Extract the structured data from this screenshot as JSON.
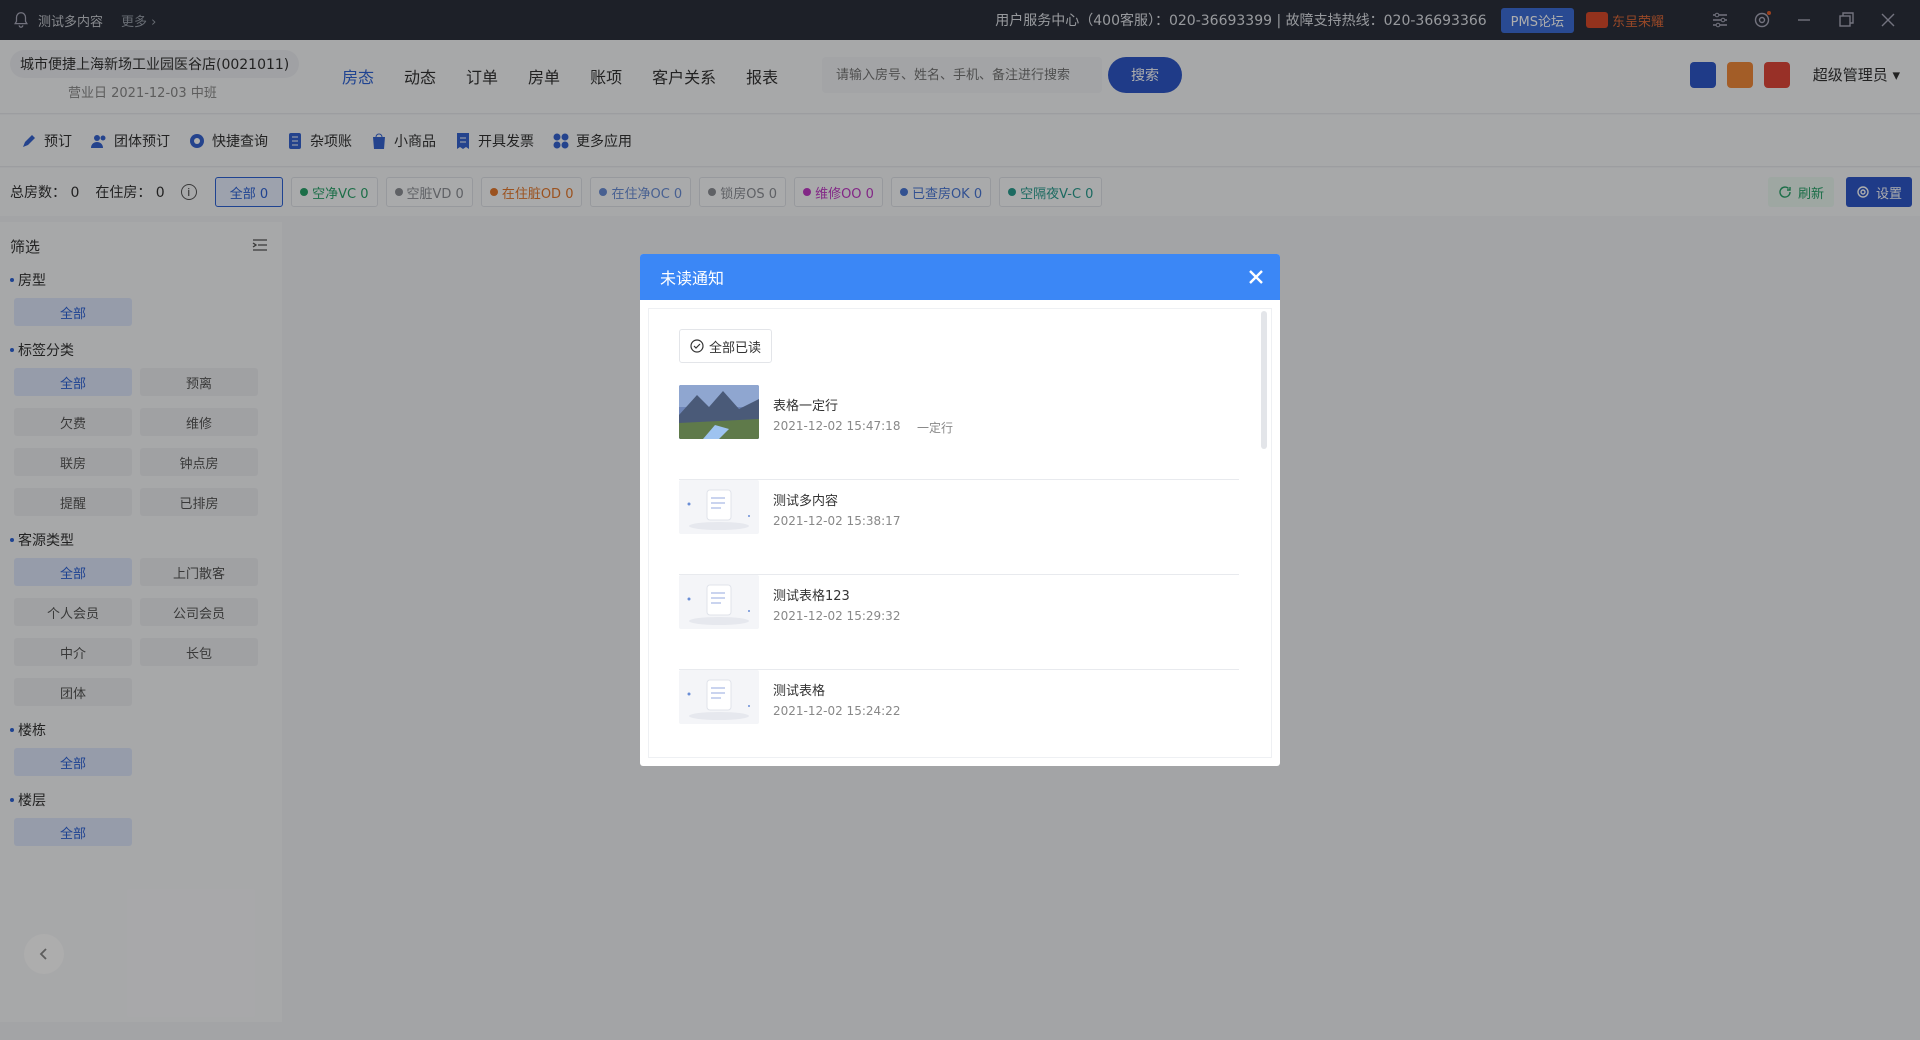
{
  "topbar": {
    "notice_text": "测试多内容",
    "more_label": "更多 ›",
    "service_text": "用户服务中心（400客服）：020-36693399 | 故障支持热线：020-36693366",
    "pms_label": "PMS论坛",
    "brand_label": "东呈荣耀"
  },
  "header": {
    "store_name": "城市便捷上海新场工业园医谷店(0021011)",
    "business_day": "营业日  2021-12-03  中班",
    "nav": [
      "房态",
      "动态",
      "订单",
      "房单",
      "账项",
      "客户关系",
      "报表"
    ],
    "search_placeholder": "请输入房号、姓名、手机、备注进行搜索",
    "search_button": "搜索",
    "user_label": "超级管理员 ▾"
  },
  "toolbar": {
    "items": [
      "预订",
      "团体预订",
      "快捷查询",
      "杂项账",
      "小商品",
      "开具发票",
      "更多应用"
    ]
  },
  "status": {
    "total_rooms": "总房数：  0",
    "in_house": "在住房：  0",
    "chips": [
      {
        "label": "全部 0",
        "color": ""
      },
      {
        "label": "空净VC 0",
        "color": "#2aa36b"
      },
      {
        "label": "空脏VD 0",
        "color": "#8c8f96"
      },
      {
        "label": "在住脏OD 0",
        "color": "#e57a2e"
      },
      {
        "label": "在住净OC 0",
        "color": "#6a8ed6"
      },
      {
        "label": "锁房OS 0",
        "color": "#8c8f96"
      },
      {
        "label": "维修OO 0",
        "color": "#c03ac6"
      },
      {
        "label": "已查房OK 0",
        "color": "#4a78d6"
      },
      {
        "label": "空隔夜V-C 0",
        "color": "#2a9d8f"
      }
    ],
    "refresh_label": "刷新",
    "setting_label": "设置"
  },
  "sidebar": {
    "title": "筛选",
    "groups": [
      {
        "title": "房型",
        "items": [
          "全部"
        ]
      },
      {
        "title": "标签分类",
        "items": [
          "全部",
          "预离",
          "欠费",
          "维修",
          "联房",
          "钟点房",
          "提醒",
          "已排房"
        ]
      },
      {
        "title": "客源类型",
        "items": [
          "全部",
          "上门散客",
          "个人会员",
          "公司会员",
          "中介",
          "长包",
          "团体"
        ]
      },
      {
        "title": "楼栋",
        "items": [
          "全部"
        ]
      },
      {
        "title": "楼层",
        "items": [
          "全部"
        ]
      }
    ]
  },
  "modal": {
    "title": "未读通知",
    "read_all": "全部已读",
    "notifications": [
      {
        "title": "表格一定行",
        "time": "2021-12-02 15:47:18",
        "tag": "一定行",
        "thumb": "photo"
      },
      {
        "title": "测试多内容",
        "time": "2021-12-02 15:38:17",
        "tag": "",
        "thumb": "doc"
      },
      {
        "title": "测试表格123",
        "time": "2021-12-02 15:29:32",
        "tag": "",
        "thumb": "doc"
      },
      {
        "title": "测试表格",
        "time": "2021-12-02 15:24:22",
        "tag": "",
        "thumb": "doc"
      }
    ]
  },
  "colors": {
    "accent": "#2e63d6",
    "modal_header": "#3b87f6",
    "topbar": "#2b303b"
  }
}
